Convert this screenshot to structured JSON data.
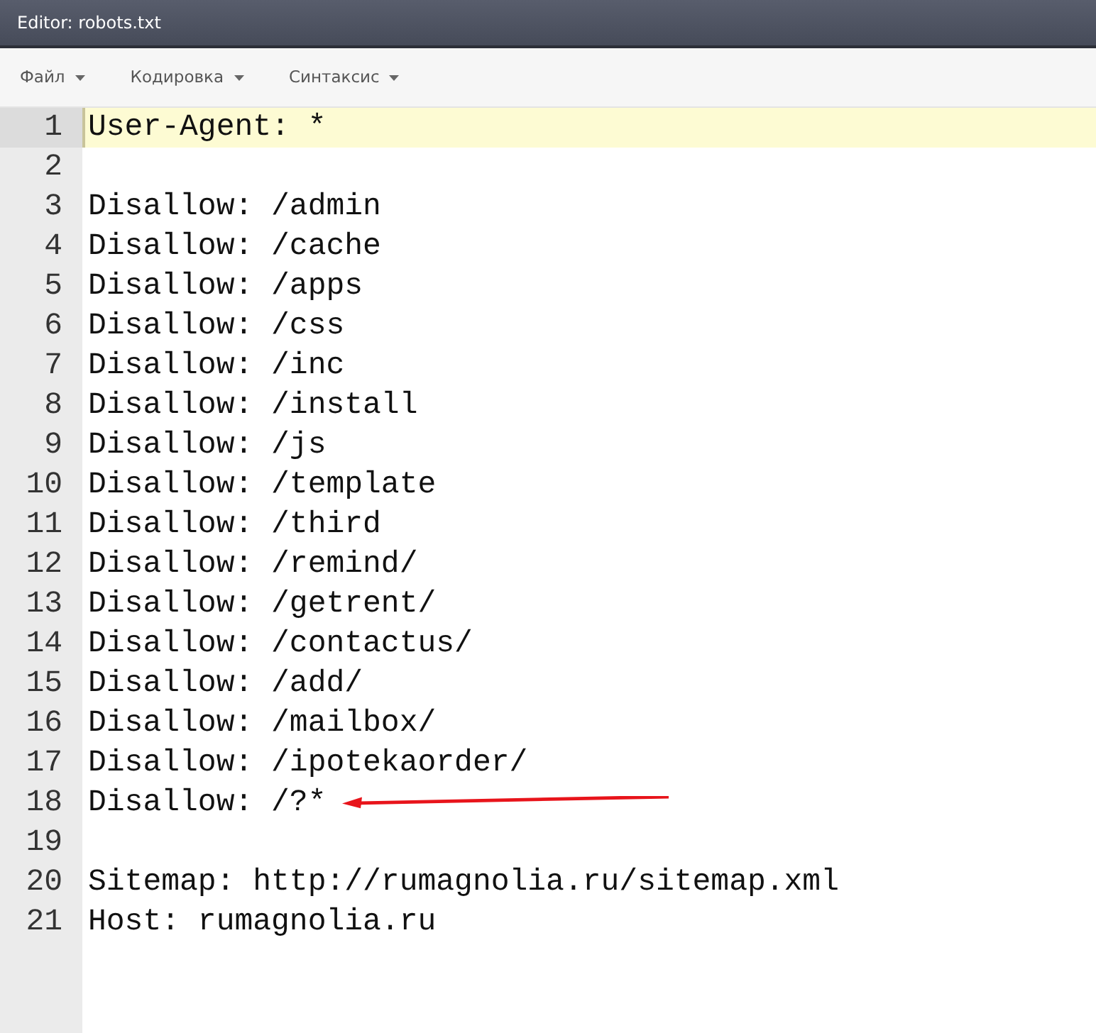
{
  "window": {
    "title": "Editor: robots.txt"
  },
  "menu": [
    {
      "label": "Файл"
    },
    {
      "label": "Кодировка"
    },
    {
      "label": "Синтаксис"
    }
  ],
  "editor": {
    "lines": [
      {
        "number": "1",
        "text": "User-Agent: *",
        "active": true,
        "arrow": false
      },
      {
        "number": "2",
        "active": false,
        "arrow": false
      },
      {
        "number": "3",
        "text": "Disallow: /admin",
        "active": false,
        "arrow": false
      },
      {
        "number": "4",
        "text": "Disallow: /cache",
        "active": false,
        "arrow": false
      },
      {
        "number": "5",
        "text": "Disallow: /apps",
        "active": false,
        "arrow": false
      },
      {
        "number": "6",
        "text": "Disallow: /css",
        "active": false,
        "arrow": false
      },
      {
        "number": "7",
        "text": "Disallow: /inc",
        "active": false,
        "arrow": false
      },
      {
        "number": "8",
        "text": "Disallow: /install",
        "active": false,
        "arrow": false
      },
      {
        "number": "9",
        "text": "Disallow: /js",
        "active": false,
        "arrow": false
      },
      {
        "number": "10",
        "text": "Disallow: /template",
        "active": false,
        "arrow": false
      },
      {
        "number": "11",
        "text": "Disallow: /third",
        "active": false,
        "arrow": false
      },
      {
        "number": "12",
        "text": "Disallow: /remind/",
        "active": false,
        "arrow": false
      },
      {
        "number": "13",
        "text": "Disallow: /getrent/",
        "active": false,
        "arrow": false
      },
      {
        "number": "14",
        "text": "Disallow: /contactus/",
        "active": false,
        "arrow": false
      },
      {
        "number": "15",
        "text": "Disallow: /add/",
        "active": false,
        "arrow": false
      },
      {
        "number": "16",
        "text": "Disallow: /mailbox/",
        "active": false,
        "arrow": false
      },
      {
        "number": "17",
        "text": "Disallow: /ipotekaorder/",
        "active": false,
        "arrow": false
      },
      {
        "number": "18",
        "text": "Disallow: /?*",
        "active": false,
        "arrow": true
      },
      {
        "number": "19",
        "active": false,
        "arrow": false
      },
      {
        "number": "20",
        "text": "Sitemap: http://rumagnolia.ru/sitemap.xml",
        "active": false,
        "arrow": false
      },
      {
        "number": "21",
        "text": "Host: rumagnolia.ru",
        "active": false,
        "arrow": false
      }
    ]
  }
}
